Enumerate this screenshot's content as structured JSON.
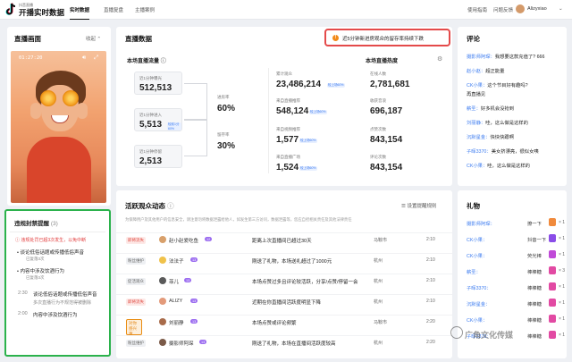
{
  "topbar": {
    "brand_small": "抖音直播",
    "brand": "开播实时数据",
    "nav": [
      "实时数据",
      "直播复盘",
      "主播案例"
    ],
    "links": [
      "使用指南",
      "问题反馈"
    ],
    "user": "Alizyxiao"
  },
  "preview": {
    "title": "直播画面",
    "collapse": "收起",
    "timecode": "01:27:20"
  },
  "violation": {
    "title": "违规封禁提醒",
    "count": "(3)",
    "warning": "违规处罚已超3次发生，以免中断",
    "items": [
      {
        "text": "谈论低俗话题或传播低俗声音",
        "sub": "已复落3次"
      },
      {
        "text": "内容中涉及饮酒行为",
        "sub": "已复落3次"
      }
    ],
    "log": [
      {
        "time": "2:30",
        "text": "谈论低俗话题或传播低俗声音",
        "sub": "多次直播行为不规范得被删除"
      },
      {
        "time": "2:00",
        "text": "内容中涉及饮酒行为"
      }
    ]
  },
  "stats": {
    "title": "直播数据",
    "alert": "近5分钟新进房观众的留存率持续下跌",
    "flow_label": "本场直播流量",
    "funnel": [
      {
        "label": "近1分钟曝光",
        "value": "512,513",
        "badge": ""
      },
      {
        "label": "近1分钟进入",
        "value": "5,513",
        "badge": "较前1分60%"
      },
      {
        "label": "近1分钟停留",
        "value": "2,513",
        "badge": ""
      }
    ],
    "rates": [
      {
        "label": "进房率",
        "value": "60%"
      },
      {
        "label": "留存率",
        "value": "30%"
      }
    ],
    "metrics": [
      {
        "label": "累计观众",
        "value": "23,486,214",
        "badge": "较上场60%"
      },
      {
        "label": "来自直播推荐",
        "value": "548,124",
        "badge": "较上场60%"
      },
      {
        "label": "来自视频推荐",
        "value": "1,577",
        "badge": "较上场60%"
      },
      {
        "label": "来自直播广场",
        "value": "1,524",
        "badge": "较上场60%"
      }
    ],
    "heat_label": "本场直播热度",
    "heat": [
      {
        "label": "在线人数",
        "value": "2,781,681"
      },
      {
        "label": "收获音浪",
        "value": "696,187"
      },
      {
        "label": "点赞次数",
        "value": "843,154"
      },
      {
        "label": "评论次数",
        "value": "843,154"
      }
    ]
  },
  "activity": {
    "title": "活跃观众动态",
    "settings": "设置提醒规则",
    "desc": "为保障用户及其他用户的信息安全，请注意勿将数据泄露给他人，如发生第三方访问，数据泄露等，您应自担相关责任及其他法律责任",
    "rows": [
      {
        "tag": "即将流失",
        "tag_style": "red",
        "name": "赵小赵爱吃鱼",
        "level": "12",
        "text": "距离上次直播间已超过30天",
        "loc": "马鞍市",
        "time": "2:10"
      },
      {
        "tag": "粉丝维护",
        "tag_style": "gray",
        "name": "法法子",
        "level": "13",
        "text": "刚送了礼物，本场送礼超过了1000元",
        "loc": "杭州",
        "time": "2:10"
      },
      {
        "tag": "促活观众",
        "tag_style": "gray",
        "name": "菲儿",
        "level": "13",
        "text": "本场点赞过多且评论较活跃，分享/点赞/停留一会",
        "loc": "杭州",
        "time": "2:10"
      },
      {
        "tag": "即将流失",
        "tag_style": "red",
        "name": "ALIZY",
        "level": "13",
        "text": "近期在你直播间活跃度明显下降",
        "loc": "杭州",
        "time": "2:10"
      },
      {
        "tag": "对你感兴趣",
        "tag_style": "orange",
        "name": "刘丽静",
        "level": "13",
        "text": "本场点赞或评论频繁",
        "loc": "马鞍市",
        "time": "2:20"
      },
      {
        "tag": "粉丝维护",
        "tag_style": "gray",
        "name": "摄影师阿琛",
        "level": "13",
        "text": "刚送了礼物，本场在直播间活跃度较高",
        "loc": "杭州",
        "time": "2:20"
      }
    ]
  },
  "comments": {
    "title": "评论",
    "rows": [
      {
        "user": "摄影师阿琛：",
        "text": "我想要这款充值了? 666"
      },
      {
        "user": "赵小赵：",
        "text": "超正能量"
      },
      {
        "user": "CK小果：",
        "text": "这个节目好有趣吗?"
      },
      {
        "user": "",
        "text": "再直播见"
      },
      {
        "user": "薪圣：",
        "text": "好多机会没抢到"
      },
      {
        "user": "刘丽静：",
        "text": "哇，这么做是这样的"
      },
      {
        "user": "沉默星金：",
        "text": "快快快跟啊"
      },
      {
        "user": "子晖3370：",
        "text": "美女挤漂亮，很似女咦"
      },
      {
        "user": "CK小果：",
        "text": "哇，这么做是这样的"
      }
    ]
  },
  "gifts": {
    "title": "礼物",
    "rows": [
      {
        "user": "摄影师阿琛：",
        "action": "撩一下",
        "mult": "× 1",
        "color": "#f08a3c"
      },
      {
        "user": "CK小果：",
        "action": "抖音一下",
        "mult": "× 1",
        "color": "#8a4de8"
      },
      {
        "user": "CK小果：",
        "action": "荧光棒",
        "mult": "× 1",
        "color": "#c04ad8"
      },
      {
        "user": "薪圣：",
        "action": "棒棒糖",
        "mult": "× 3",
        "color": "#e24aa3"
      },
      {
        "user": "子晖3370：",
        "action": "棒棒糖",
        "mult": "× 1",
        "color": "#e24aa3"
      },
      {
        "user": "沉默星金：",
        "action": "棒棒糖",
        "mult": "× 1",
        "color": "#e24aa3"
      },
      {
        "user": "CK小果：",
        "action": "棒棒糖",
        "mult": "× 1",
        "color": "#e24aa3"
      },
      {
        "user": "子晖3370：",
        "action": "棒棒糖",
        "mult": "× 1",
        "color": "#e24aa3"
      }
    ]
  },
  "watermark": "广角文化传媒"
}
